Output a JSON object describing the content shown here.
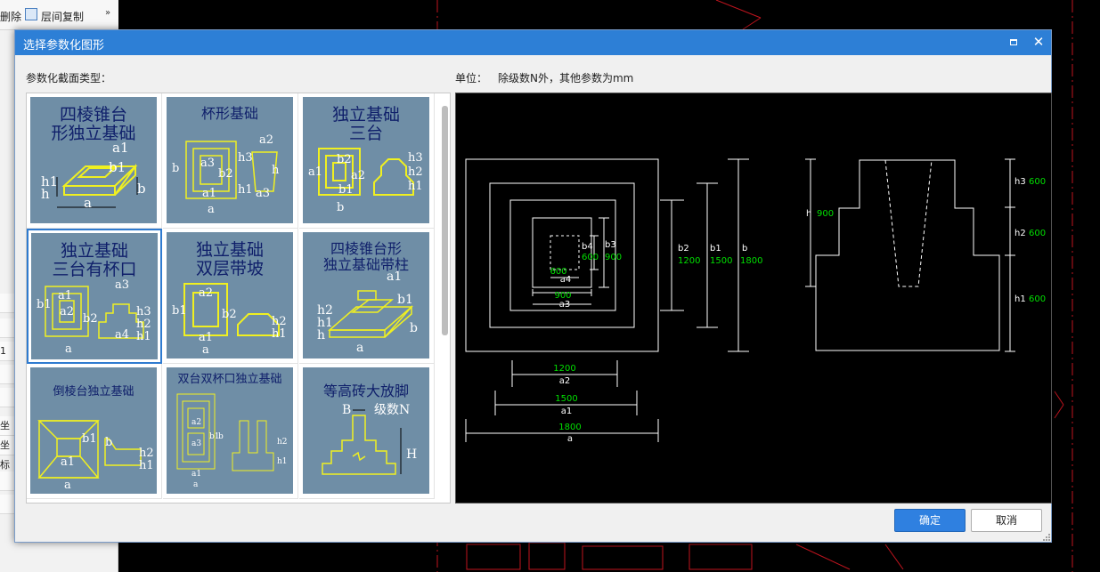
{
  "background_app": {
    "toolbar": {
      "delete_label": "删除",
      "copy_floor_label": "层间复制",
      "more_glyph": "»"
    },
    "rows": [
      "1",
      "坐标",
      "坐标"
    ]
  },
  "dialog": {
    "title": "选择参数化图形",
    "section_label": "参数化截面类型：",
    "unit_prefix": "单位：",
    "unit_text": "除级数N外，其他参数为mm",
    "ok_label": "确定",
    "cancel_label": "取消"
  },
  "gallery": {
    "items": [
      {
        "title_line1": "四棱锥台",
        "title_line2": "形独立基础",
        "selected": false
      },
      {
        "title_line1": "杯形基础",
        "title_line2": "",
        "selected": false
      },
      {
        "title_line1": "独立基础",
        "title_line2": "三台",
        "selected": false
      },
      {
        "title_line1": "独立基础",
        "title_line2": "三台有杯口",
        "selected": true
      },
      {
        "title_line1": "独立基础",
        "title_line2": "双层带坡",
        "selected": false
      },
      {
        "title_line1": "四棱锥台形",
        "title_line2": "独立基础带柱",
        "selected": false
      },
      {
        "title_line1": "倒棱台独立基础",
        "title_line2": "",
        "selected": false
      },
      {
        "title_line1": "双台双杯口独立基础",
        "title_line2": "",
        "selected": false
      },
      {
        "title_line1": "等高砖大放脚",
        "title_line2": "",
        "selected": false
      }
    ],
    "thumb_labels": {
      "a": "a",
      "a1": "a1",
      "a2": "a2",
      "a3": "a3",
      "a4": "a4",
      "b": "b",
      "b1": "b1",
      "b2": "b2",
      "b3": "b3",
      "h": "h",
      "h1": "h1",
      "h2": "h2",
      "h3": "h3",
      "H": "H",
      "B": "B",
      "levels": "级数N"
    }
  },
  "preview": {
    "plan": {
      "a": {
        "label": "a",
        "value": "1800"
      },
      "a1": {
        "label": "a1",
        "value": "1500"
      },
      "a2": {
        "label": "a2",
        "value": "1200"
      },
      "a3": {
        "label": "a3",
        "value": "900"
      },
      "a4": {
        "label": "a4",
        "value": "600"
      },
      "b": {
        "label": "b",
        "value": "1800"
      },
      "b1": {
        "label": "b1",
        "value": "1500"
      },
      "b2": {
        "label": "b2",
        "value": "1200"
      },
      "b3": {
        "label": "b3",
        "value": "900"
      },
      "b4": {
        "label": "b4",
        "value": "600"
      }
    },
    "section": {
      "h": {
        "label": "h",
        "value": "900"
      },
      "h1": {
        "label": "h1",
        "value": "600"
      },
      "h2": {
        "label": "h2",
        "value": "600"
      },
      "h3": {
        "label": "h3",
        "value": "600"
      }
    }
  },
  "colors": {
    "title_bar": "#2d7fd6",
    "dimension_value": "#00e000",
    "drawing_line": "#ffffff",
    "thumbnail_bg": "#6f8ea6",
    "thumbnail_line": "#f0f020",
    "cad_red": "#c0141e"
  },
  "icons": {
    "maximize": "maximize-icon",
    "close": "close-icon",
    "copy_floor": "copy-floor-icon"
  }
}
